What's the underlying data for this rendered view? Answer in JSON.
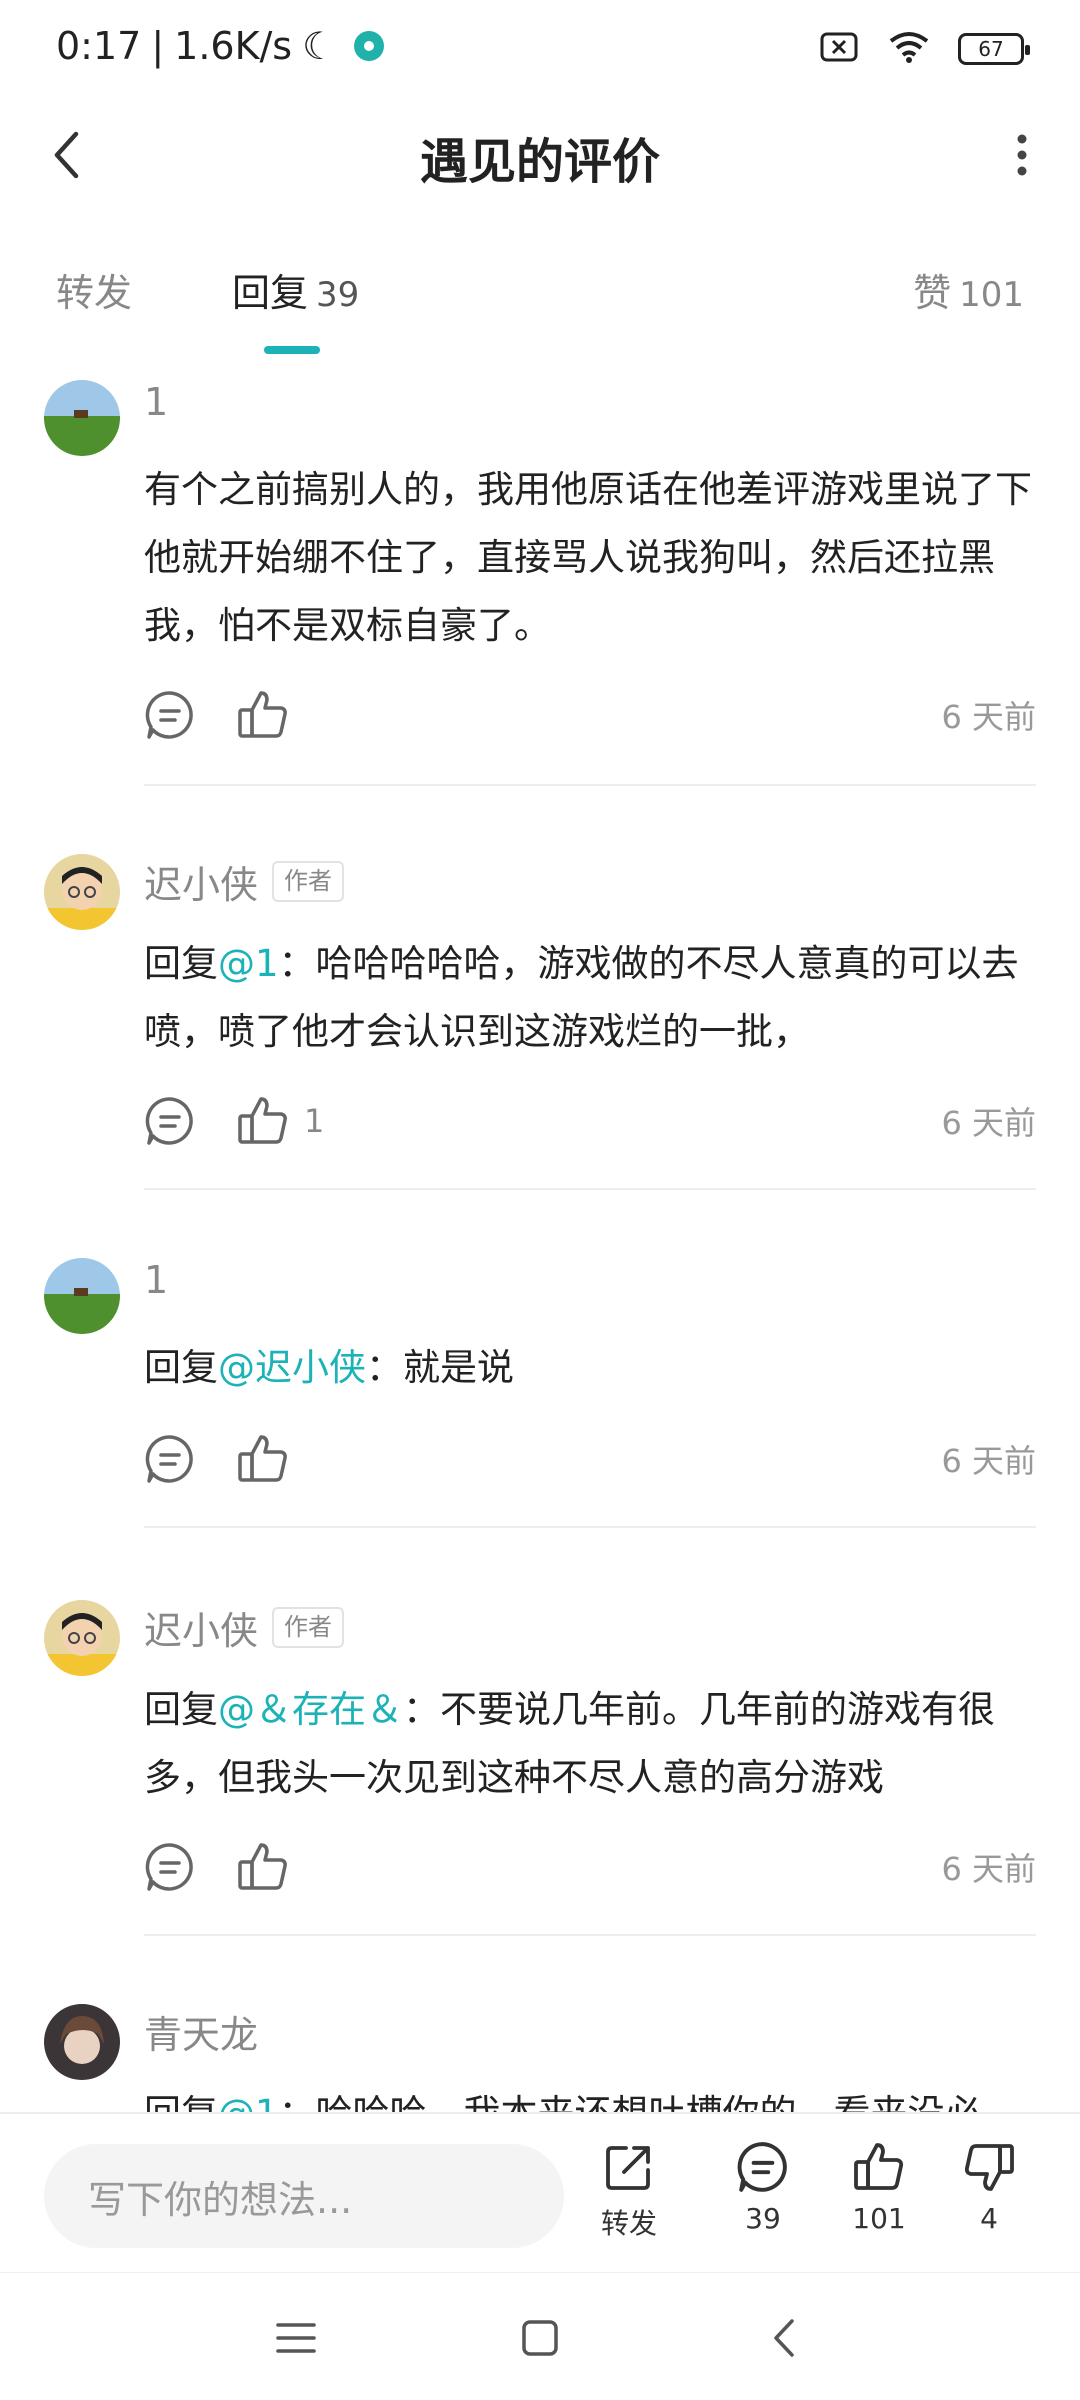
{
  "status_bar": {
    "time": "0:17",
    "network_speed": "1.6K/s",
    "battery_level": "67",
    "icons": [
      "moon-icon",
      "vpn-icon",
      "no-sim-icon",
      "wifi-icon",
      "battery-icon"
    ]
  },
  "header": {
    "title": "遇见的评价"
  },
  "tabs": {
    "forward": {
      "label": "转发"
    },
    "reply": {
      "label": "回复",
      "count": "39"
    },
    "likes": {
      "label": "赞",
      "count": "101"
    }
  },
  "comments": [
    {
      "author": "1",
      "badge": "",
      "reply_prefix": "",
      "mention": "",
      "separator": "",
      "text": "有个之前搞别人的，我用他原话在他差评游戏里说了下他就开始绷不住了，直接骂人说我狗叫，然后还拉黑我，怕不是双标自豪了。",
      "likes": "",
      "time": "6 天前"
    },
    {
      "author": "迟小侠",
      "badge": "作者",
      "reply_prefix": "回复",
      "mention": "@1",
      "separator": "：",
      "text": "哈哈哈哈哈，游戏做的不尽人意真的可以去喷，喷了他才会认识到这游戏烂的一批，",
      "likes": "1",
      "time": "6 天前"
    },
    {
      "author": "1",
      "badge": "",
      "reply_prefix": "回复",
      "mention": "@迟小侠",
      "separator": "：",
      "text": "就是说",
      "likes": "",
      "time": "6 天前"
    },
    {
      "author": "迟小侠",
      "badge": "作者",
      "reply_prefix": "回复",
      "mention": "@＆存在＆",
      "separator": "：",
      "text": "不要说几年前。几年前的游戏有很多，但我头一次见到这种不尽人意的高分游戏",
      "likes": "",
      "time": "6 天前"
    },
    {
      "author": "青天龙",
      "badge": "",
      "reply_prefix": "回复",
      "mention": "@1",
      "separator": "：",
      "text": "哈哈哈，我本来还想吐槽你的，看来没必",
      "likes": "",
      "time": ""
    }
  ],
  "bottom_bar": {
    "input_placeholder": "写下你的想法...",
    "forward_label": "转发",
    "reply_count": "39",
    "like_count": "101",
    "dislike_count": "4"
  },
  "colors": {
    "accent": "#1bb2b8",
    "text_primary": "#222222",
    "text_secondary": "#888888",
    "divider": "#ededed"
  }
}
